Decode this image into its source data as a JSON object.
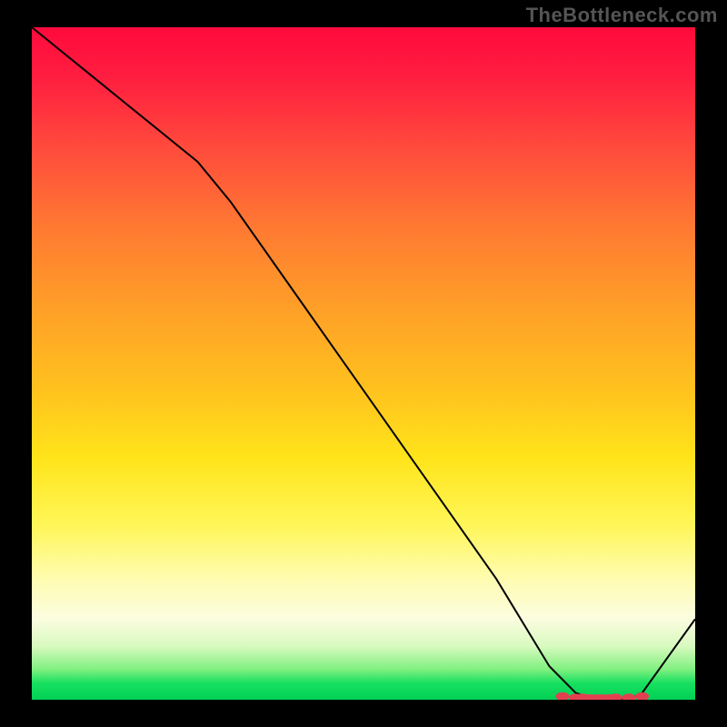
{
  "watermark": "TheBottleneck.com",
  "chart_data": {
    "type": "line",
    "title": "",
    "xlabel": "",
    "ylabel": "",
    "x": [
      0.0,
      0.1,
      0.2,
      0.25,
      0.3,
      0.4,
      0.5,
      0.6,
      0.7,
      0.78,
      0.82,
      0.85,
      0.88,
      0.9,
      0.92,
      1.0
    ],
    "y": [
      1.0,
      0.92,
      0.84,
      0.8,
      0.74,
      0.6,
      0.46,
      0.32,
      0.18,
      0.05,
      0.01,
      0.0,
      0.0,
      0.0,
      0.01,
      0.12
    ],
    "ylim": [
      0,
      1
    ],
    "xlim": [
      0,
      1
    ],
    "markers_x": [
      0.8,
      0.82,
      0.83,
      0.84,
      0.85,
      0.86,
      0.87,
      0.88,
      0.9,
      0.92
    ],
    "markers_y": [
      0.005,
      0.003,
      0.003,
      0.002,
      0.002,
      0.002,
      0.002,
      0.003,
      0.003,
      0.005
    ],
    "annotations": [],
    "legend": []
  }
}
